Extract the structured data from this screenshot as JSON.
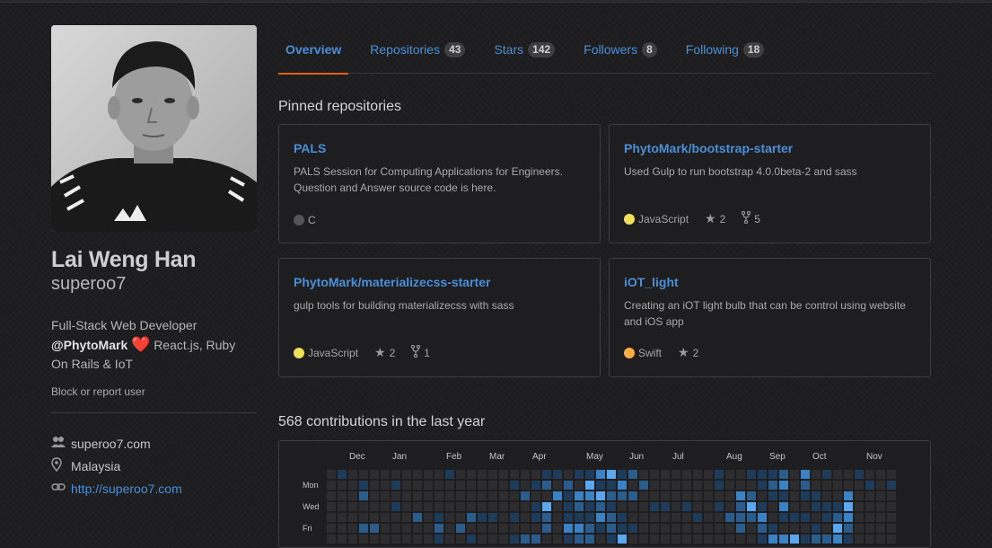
{
  "profile": {
    "full_name": "Lai Weng Han",
    "username": "superoo7",
    "bio_line1": "Full-Stack Web Developer",
    "bio_org": "@PhytoMark",
    "bio_heart": "❤️",
    "bio_line2a": " React.js, Ruby",
    "bio_line3": "On Rails & IoT",
    "block_text": "Block or report user",
    "org_name": "superoo7.com",
    "location": "Malaysia",
    "website": "http://superoo7.com",
    "icons": [
      "people-icon",
      "location-pin-icon",
      "link-icon"
    ]
  },
  "tabs": [
    {
      "label": "Overview",
      "count": null,
      "active": true
    },
    {
      "label": "Repositories",
      "count": "43",
      "active": false
    },
    {
      "label": "Stars",
      "count": "142",
      "active": false
    },
    {
      "label": "Followers",
      "count": "8",
      "active": false
    },
    {
      "label": "Following",
      "count": "18",
      "active": false
    }
  ],
  "pinned": {
    "title": "Pinned repositories",
    "repos": [
      {
        "name": "PALS",
        "desc": "PALS Session for Computing Applications for Engineers. Question and Answer source code is here.",
        "lang": "C",
        "lang_color": "#555555",
        "stars": null,
        "forks": null
      },
      {
        "name": "PhytoMark/bootstrap-starter",
        "desc": "Used Gulp to run bootstrap 4.0.0beta-2 and sass",
        "lang": "JavaScript",
        "lang_color": "#f1e05a",
        "stars": "2",
        "forks": "5"
      },
      {
        "name": "PhytoMark/materializecss-starter",
        "desc": "gulp tools for building materializecss with sass",
        "lang": "JavaScript",
        "lang_color": "#f1e05a",
        "stars": "2",
        "forks": "1"
      },
      {
        "name": "iOT_light",
        "desc": "Creating an iOT light bulb that can be control using website and iOS app",
        "lang": "Swift",
        "lang_color": "#ffac45",
        "stars": "2",
        "forks": null
      }
    ]
  },
  "contributions": {
    "title": "568 contributions in the last year",
    "months": [
      "Dec",
      "Jan",
      "Feb",
      "Mar",
      "Apr",
      "May",
      "Jun",
      "Jul",
      "Aug",
      "Sep",
      "Oct",
      "Nov"
    ],
    "days": [
      "Mon",
      "Wed",
      "Fri"
    ],
    "colors": {
      "empty": "#2d2d30",
      "l1": "#1f3b5a",
      "l2": "#2a5c8c",
      "l3": "#3b82c4",
      "l4": "#5aa7ef"
    }
  }
}
